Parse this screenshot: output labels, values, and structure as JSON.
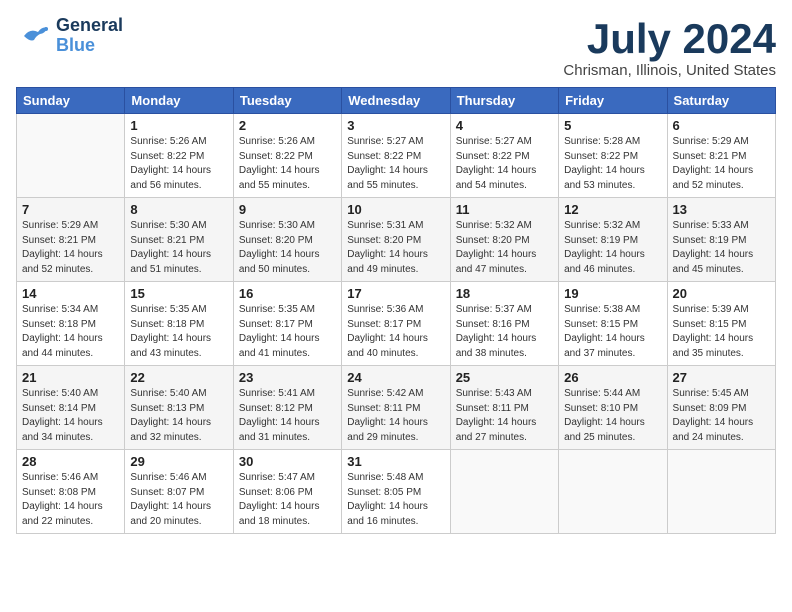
{
  "header": {
    "logo": {
      "general": "General",
      "blue": "Blue"
    },
    "title": "July 2024",
    "location": "Chrisman, Illinois, United States"
  },
  "weekdays": [
    "Sunday",
    "Monday",
    "Tuesday",
    "Wednesday",
    "Thursday",
    "Friday",
    "Saturday"
  ],
  "weeks": [
    [
      {
        "day": "",
        "info": ""
      },
      {
        "day": "1",
        "info": "Sunrise: 5:26 AM\nSunset: 8:22 PM\nDaylight: 14 hours\nand 56 minutes."
      },
      {
        "day": "2",
        "info": "Sunrise: 5:26 AM\nSunset: 8:22 PM\nDaylight: 14 hours\nand 55 minutes."
      },
      {
        "day": "3",
        "info": "Sunrise: 5:27 AM\nSunset: 8:22 PM\nDaylight: 14 hours\nand 55 minutes."
      },
      {
        "day": "4",
        "info": "Sunrise: 5:27 AM\nSunset: 8:22 PM\nDaylight: 14 hours\nand 54 minutes."
      },
      {
        "day": "5",
        "info": "Sunrise: 5:28 AM\nSunset: 8:22 PM\nDaylight: 14 hours\nand 53 minutes."
      },
      {
        "day": "6",
        "info": "Sunrise: 5:29 AM\nSunset: 8:21 PM\nDaylight: 14 hours\nand 52 minutes."
      }
    ],
    [
      {
        "day": "7",
        "info": "Sunrise: 5:29 AM\nSunset: 8:21 PM\nDaylight: 14 hours\nand 52 minutes."
      },
      {
        "day": "8",
        "info": "Sunrise: 5:30 AM\nSunset: 8:21 PM\nDaylight: 14 hours\nand 51 minutes."
      },
      {
        "day": "9",
        "info": "Sunrise: 5:30 AM\nSunset: 8:20 PM\nDaylight: 14 hours\nand 50 minutes."
      },
      {
        "day": "10",
        "info": "Sunrise: 5:31 AM\nSunset: 8:20 PM\nDaylight: 14 hours\nand 49 minutes."
      },
      {
        "day": "11",
        "info": "Sunrise: 5:32 AM\nSunset: 8:20 PM\nDaylight: 14 hours\nand 47 minutes."
      },
      {
        "day": "12",
        "info": "Sunrise: 5:32 AM\nSunset: 8:19 PM\nDaylight: 14 hours\nand 46 minutes."
      },
      {
        "day": "13",
        "info": "Sunrise: 5:33 AM\nSunset: 8:19 PM\nDaylight: 14 hours\nand 45 minutes."
      }
    ],
    [
      {
        "day": "14",
        "info": "Sunrise: 5:34 AM\nSunset: 8:18 PM\nDaylight: 14 hours\nand 44 minutes."
      },
      {
        "day": "15",
        "info": "Sunrise: 5:35 AM\nSunset: 8:18 PM\nDaylight: 14 hours\nand 43 minutes."
      },
      {
        "day": "16",
        "info": "Sunrise: 5:35 AM\nSunset: 8:17 PM\nDaylight: 14 hours\nand 41 minutes."
      },
      {
        "day": "17",
        "info": "Sunrise: 5:36 AM\nSunset: 8:17 PM\nDaylight: 14 hours\nand 40 minutes."
      },
      {
        "day": "18",
        "info": "Sunrise: 5:37 AM\nSunset: 8:16 PM\nDaylight: 14 hours\nand 38 minutes."
      },
      {
        "day": "19",
        "info": "Sunrise: 5:38 AM\nSunset: 8:15 PM\nDaylight: 14 hours\nand 37 minutes."
      },
      {
        "day": "20",
        "info": "Sunrise: 5:39 AM\nSunset: 8:15 PM\nDaylight: 14 hours\nand 35 minutes."
      }
    ],
    [
      {
        "day": "21",
        "info": "Sunrise: 5:40 AM\nSunset: 8:14 PM\nDaylight: 14 hours\nand 34 minutes."
      },
      {
        "day": "22",
        "info": "Sunrise: 5:40 AM\nSunset: 8:13 PM\nDaylight: 14 hours\nand 32 minutes."
      },
      {
        "day": "23",
        "info": "Sunrise: 5:41 AM\nSunset: 8:12 PM\nDaylight: 14 hours\nand 31 minutes."
      },
      {
        "day": "24",
        "info": "Sunrise: 5:42 AM\nSunset: 8:11 PM\nDaylight: 14 hours\nand 29 minutes."
      },
      {
        "day": "25",
        "info": "Sunrise: 5:43 AM\nSunset: 8:11 PM\nDaylight: 14 hours\nand 27 minutes."
      },
      {
        "day": "26",
        "info": "Sunrise: 5:44 AM\nSunset: 8:10 PM\nDaylight: 14 hours\nand 25 minutes."
      },
      {
        "day": "27",
        "info": "Sunrise: 5:45 AM\nSunset: 8:09 PM\nDaylight: 14 hours\nand 24 minutes."
      }
    ],
    [
      {
        "day": "28",
        "info": "Sunrise: 5:46 AM\nSunset: 8:08 PM\nDaylight: 14 hours\nand 22 minutes."
      },
      {
        "day": "29",
        "info": "Sunrise: 5:46 AM\nSunset: 8:07 PM\nDaylight: 14 hours\nand 20 minutes."
      },
      {
        "day": "30",
        "info": "Sunrise: 5:47 AM\nSunset: 8:06 PM\nDaylight: 14 hours\nand 18 minutes."
      },
      {
        "day": "31",
        "info": "Sunrise: 5:48 AM\nSunset: 8:05 PM\nDaylight: 14 hours\nand 16 minutes."
      },
      {
        "day": "",
        "info": ""
      },
      {
        "day": "",
        "info": ""
      },
      {
        "day": "",
        "info": ""
      }
    ]
  ]
}
